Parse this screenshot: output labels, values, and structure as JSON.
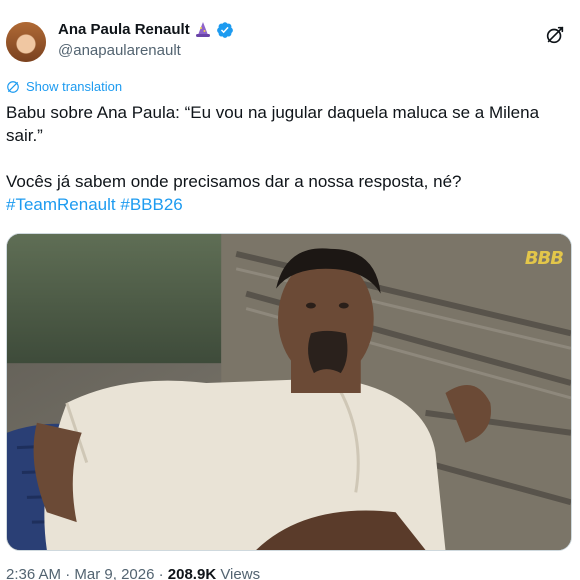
{
  "author": {
    "display_name": "Ana Paula Renault",
    "handle": "@anapaularenault",
    "emoji_icon": "wizard-emoji",
    "verified_icon": "verified-badge-icon",
    "verified_color": "#1d9bf0"
  },
  "actions": {
    "grok_icon": "grok-icon"
  },
  "translate": {
    "label": "Show translation",
    "icon": "translate-icon"
  },
  "tweet": {
    "line1": "Babu sobre Ana Paula: “Eu vou na jugular daquela maluca se a Milena sair.”",
    "line2": "Vocês já sabem onde precisamos dar a nossa resposta, né?",
    "hashtags": [
      "#TeamRenault",
      "#BBB26"
    ]
  },
  "media": {
    "watermark": "BBB"
  },
  "meta": {
    "time": "2:36 AM",
    "separator1": " · ",
    "date": "Mar 9, 2026",
    "separator2": " · ",
    "views_count": "208.9K",
    "views_label": " Views"
  },
  "colors": {
    "accent": "#1d9bf0",
    "text": "#0f1419",
    "muted": "#536471"
  }
}
